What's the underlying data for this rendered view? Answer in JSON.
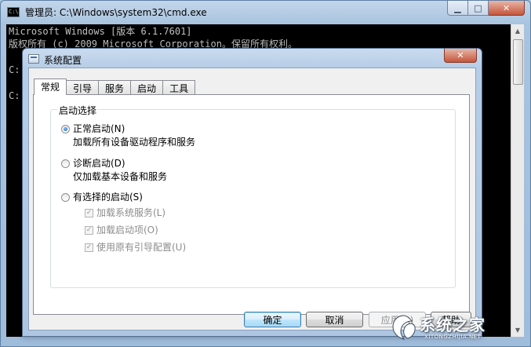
{
  "cmd": {
    "title": "管理员: C:\\Windows\\system32\\cmd.exe",
    "icon_text": "C:\\",
    "lines": [
      "Microsoft Windows [版本 6.1.7601]",
      "版权所有 (c) 2009 Microsoft Corporation。保留所有权利。",
      "C:",
      "C:"
    ],
    "minimize_glyph": "▁",
    "maximize_glyph": "□",
    "close_glyph": "✕",
    "scroll_up_glyph": "▲",
    "scroll_down_glyph": "▼"
  },
  "dialog": {
    "title": "系统配置",
    "close_glyph": "✕",
    "tabs": [
      "常规",
      "引导",
      "服务",
      "启动",
      "工具"
    ],
    "active_tab": 0,
    "group_label": "启动选择",
    "options": [
      {
        "label": "正常启动(N)",
        "desc": "加载所有设备驱动程序和服务",
        "checked": true
      },
      {
        "label": "诊断启动(D)",
        "desc": "仅加载基本设备和服务",
        "checked": false
      },
      {
        "label": "有选择的启动(S)",
        "desc": "",
        "checked": false
      }
    ],
    "sub_options": [
      {
        "label": "加载系统服务(L)",
        "checked": true
      },
      {
        "label": "加载启动项(O)",
        "checked": true
      },
      {
        "label": "使用原有引导配置(U)",
        "checked": true
      }
    ],
    "checkmark_glyph": "✓",
    "buttons": {
      "ok": "确定",
      "cancel": "取消",
      "apply": "应用(A)",
      "help": "帮助"
    }
  },
  "watermark": {
    "text": "系统之家",
    "sub": "XITONGZHIJIA.NET"
  },
  "colors": {
    "accent": "#1c5fa8",
    "close_red": "#c6553a",
    "console_bg": "#000000",
    "console_fg": "#c0c0c0"
  }
}
